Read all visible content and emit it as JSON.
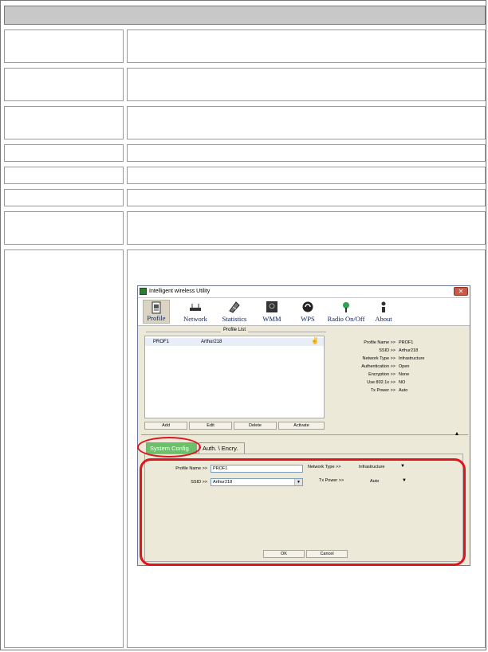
{
  "window": {
    "title": "Intelligent wireless Utility",
    "close": "✕"
  },
  "toolbar": {
    "items": [
      {
        "label": "Profile",
        "icon": "profile-icon"
      },
      {
        "label": "Network",
        "icon": "network-icon"
      },
      {
        "label": "Statistics",
        "icon": "statistics-icon"
      },
      {
        "label": "WMM",
        "icon": "wmm-icon"
      },
      {
        "label": "WPS",
        "icon": "wps-icon"
      },
      {
        "label": "Radio On/Off",
        "icon": "radio-icon"
      },
      {
        "label": "About",
        "icon": "about-icon"
      }
    ]
  },
  "profile_list": {
    "title": "Profile List",
    "rows": [
      {
        "profile": "PROF1",
        "ssid": "Arthur218"
      }
    ],
    "buttons": {
      "add": "Add",
      "edit": "Edit",
      "delete": "Delete",
      "activate": "Activate"
    }
  },
  "profile_info": [
    {
      "key": "Profile Name >>",
      "value": "PROF1"
    },
    {
      "key": "SSID >>",
      "value": "Arthur218"
    },
    {
      "key": "Network Type >>",
      "value": "Infrastructure"
    },
    {
      "key": "Authentication >>",
      "value": "Open"
    },
    {
      "key": "Encryption >>",
      "value": "None"
    },
    {
      "key": "Use 802.1x >>",
      "value": "NO"
    },
    {
      "key": "Tx Power >>",
      "value": "Auto"
    }
  ],
  "tabs": {
    "system_config": "System Config",
    "auth_encry": "Auth. \\ Encry."
  },
  "config": {
    "profile_name_label": "Profile Name >>",
    "profile_name_value": "PROF1",
    "ssid_label": "SSID >>",
    "ssid_value": "Arthur218",
    "network_type_label": "Network Type >>",
    "network_type_value": "Infrastructure",
    "tx_power_label": "Tx Power >>",
    "tx_power_value": "Auto",
    "ok": "OK",
    "cancel": "Cancel"
  },
  "colors": {
    "highlight": "#e0141c",
    "tab_active": "#6cc06a"
  }
}
